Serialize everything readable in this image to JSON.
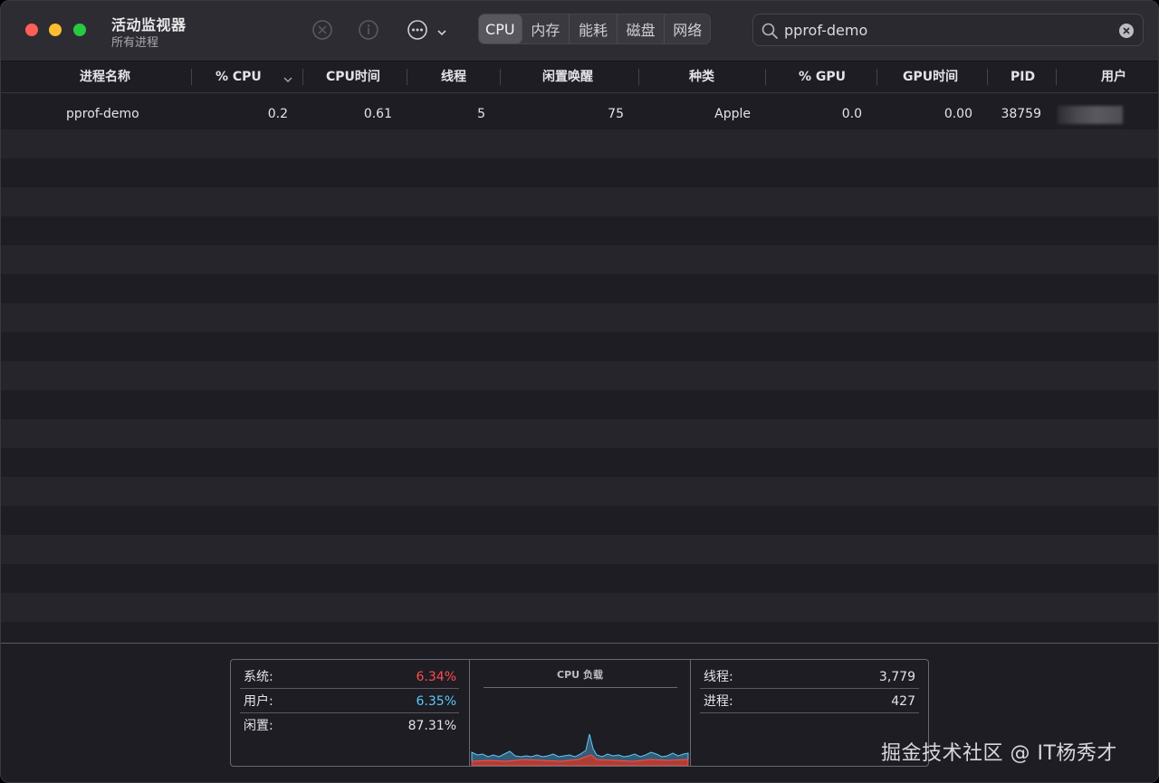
{
  "window": {
    "title": "活动监视器",
    "subtitle": "所有进程"
  },
  "toolbar": {
    "tabs": [
      {
        "label": "CPU",
        "active": true
      },
      {
        "label": "内存",
        "active": false
      },
      {
        "label": "能耗",
        "active": false
      },
      {
        "label": "磁盘",
        "active": false
      },
      {
        "label": "网络",
        "active": false
      }
    ],
    "icons": [
      "stop-process-icon",
      "info-icon",
      "more-actions-icon",
      "chevron-down-icon"
    ],
    "search": {
      "value": "pprof-demo",
      "placeholder": "搜索"
    }
  },
  "table": {
    "columns": [
      "进程名称",
      "% CPU",
      "CPU时间",
      "线程",
      "闲置唤醒",
      "种类",
      "% GPU",
      "GPU时间",
      "PID",
      "用户"
    ],
    "sort_column": "% CPU",
    "rows": [
      {
        "name": "pprof-demo",
        "cpu": "0.2",
        "cpu_time": "0.61",
        "threads": "5",
        "idle_wakeups": "75",
        "kind": "Apple",
        "gpu": "0.0",
        "gpu_time": "0.00",
        "pid": "38759"
      }
    ]
  },
  "summary": {
    "system_label": "系统:",
    "system_value": "6.34%",
    "user_label": "用户:",
    "user_value": "6.35%",
    "idle_label": "闲置:",
    "idle_value": "87.31%",
    "chart_title": "CPU 负载",
    "threads_label": "线程:",
    "threads_value": "3,779",
    "processes_label": "进程:",
    "processes_value": "427"
  },
  "colors": {
    "system": "#ff4d4d",
    "user": "#5ac8fa",
    "window_bg": "#1e1d24",
    "toolbar_bg": "#2d2c33"
  },
  "watermark": "掘金技术社区 @ IT杨秀才"
}
